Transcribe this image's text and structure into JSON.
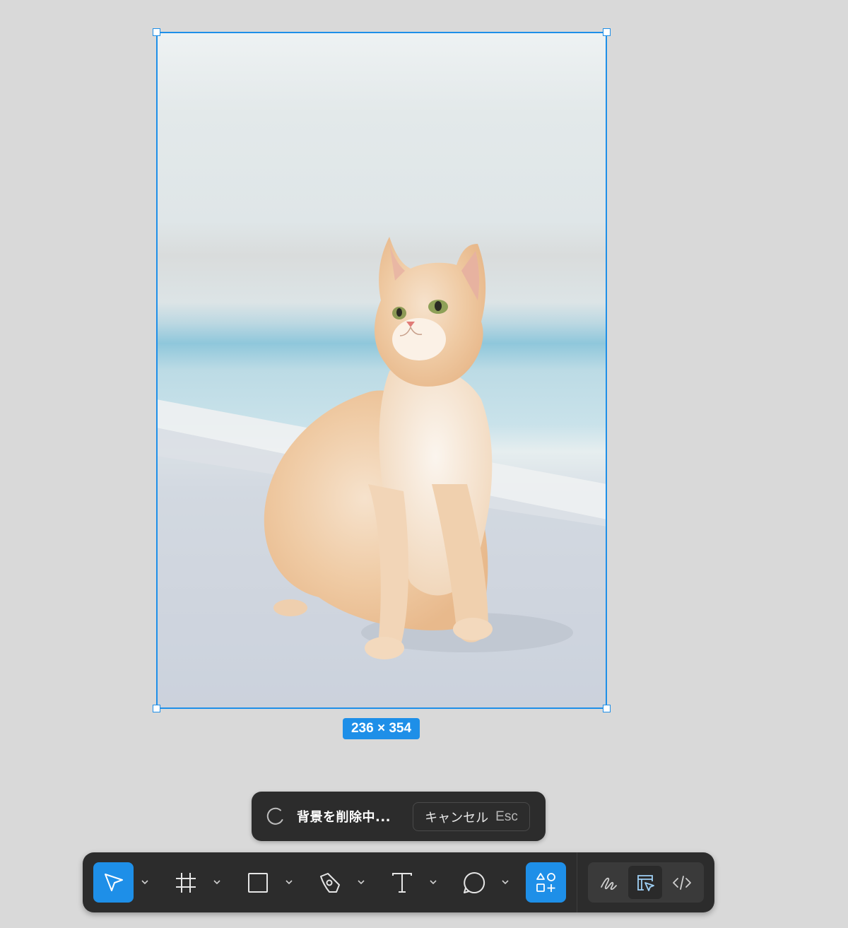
{
  "canvas": {
    "image_alt": "cat photo",
    "dimensions_label": "236 × 354"
  },
  "toast": {
    "message": "背景を削除中...",
    "cancel_label": "キャンセル",
    "cancel_shortcut": "Esc"
  },
  "toolbar": {
    "tools": [
      {
        "name": "move-tool",
        "icon": "cursor-arrow-icon",
        "active": true
      },
      {
        "name": "frame-tool",
        "icon": "hash-frame-icon",
        "active": false
      },
      {
        "name": "shape-tool",
        "icon": "rectangle-icon",
        "active": false
      },
      {
        "name": "pen-tool",
        "icon": "pen-nib-icon",
        "active": false
      },
      {
        "name": "text-tool",
        "icon": "text-t-icon",
        "active": false
      },
      {
        "name": "comment-tool",
        "icon": "speech-bubble-icon",
        "active": false
      },
      {
        "name": "actions-tool",
        "icon": "shapes-plus-icon",
        "active": true
      }
    ],
    "modes": [
      {
        "name": "draw-mode",
        "icon": "scribble-icon",
        "selected": false
      },
      {
        "name": "design-mode",
        "icon": "layout-cursor-icon",
        "selected": true
      },
      {
        "name": "dev-mode",
        "icon": "code-brackets-icon",
        "selected": false
      }
    ]
  },
  "colors": {
    "accent": "#1e8fe8",
    "toolbar_bg": "#2c2c2c",
    "canvas_bg": "#d9d9d9"
  }
}
